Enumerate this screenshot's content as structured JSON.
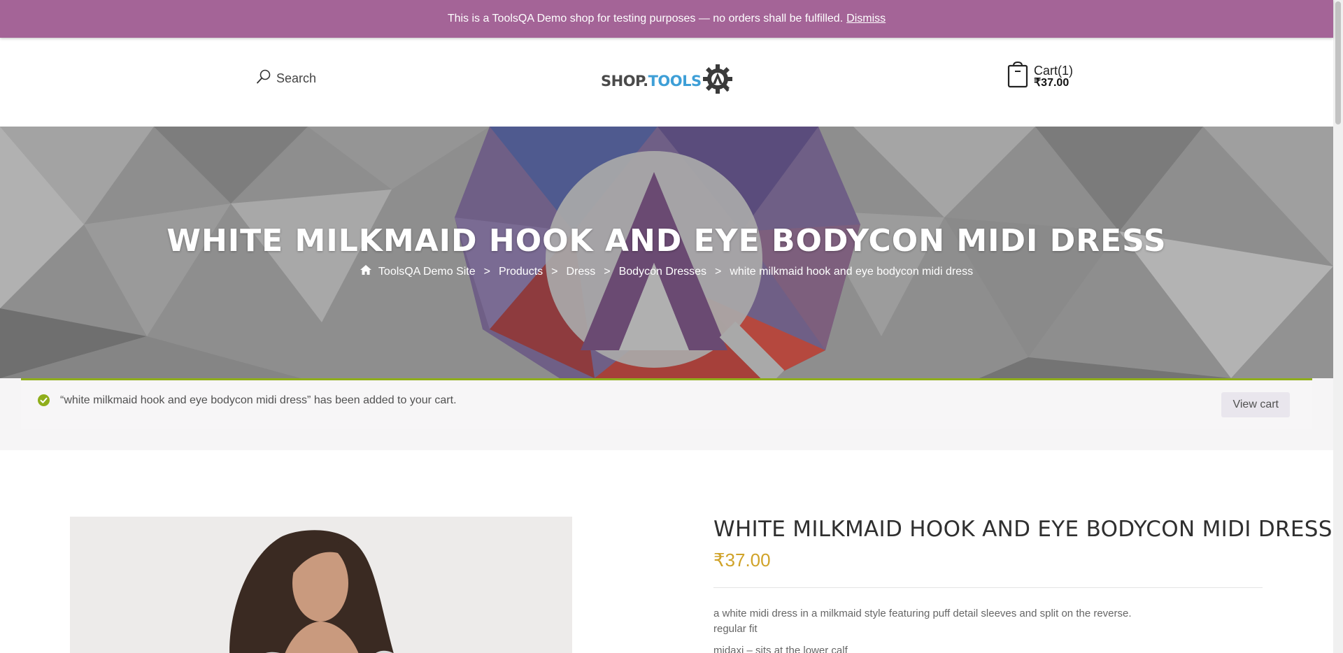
{
  "notice": {
    "text": "This is a ToolsQA Demo shop for testing purposes — no orders shall be fulfilled.",
    "dismiss_label": "Dismiss"
  },
  "header": {
    "search_label": "Search",
    "logo_text_1": "SHOP.",
    "logo_text_2": "TOOLS",
    "cart_label": "Cart(1)",
    "cart_total": "₹37.00"
  },
  "hero": {
    "title": "WHITE MILKMAID HOOK AND EYE BODYCON MIDI DRESS",
    "breadcrumb": [
      "ToolsQA Demo Site",
      "Products",
      "Dress",
      "Bodycon Dresses",
      "white milkmaid hook and eye bodycon midi dress"
    ],
    "separator": ">"
  },
  "message": {
    "text": "“white milkmaid hook and eye bodycon midi dress” has been added to your cart.",
    "button_label": "View cart"
  },
  "product": {
    "title": "WHITE MILKMAID HOOK AND EYE BODYCON MIDI DRESS",
    "price": "₹37.00",
    "description": [
      "a white midi dress in a milkmaid style featuring puff detail sleeves and split on the reverse.",
      "regular fit",
      "midaxi – sits at the lower calf"
    ]
  },
  "colors": {
    "notice_bg": "#a46497",
    "success_accent": "#8fae1b",
    "price": "#d0a329"
  }
}
